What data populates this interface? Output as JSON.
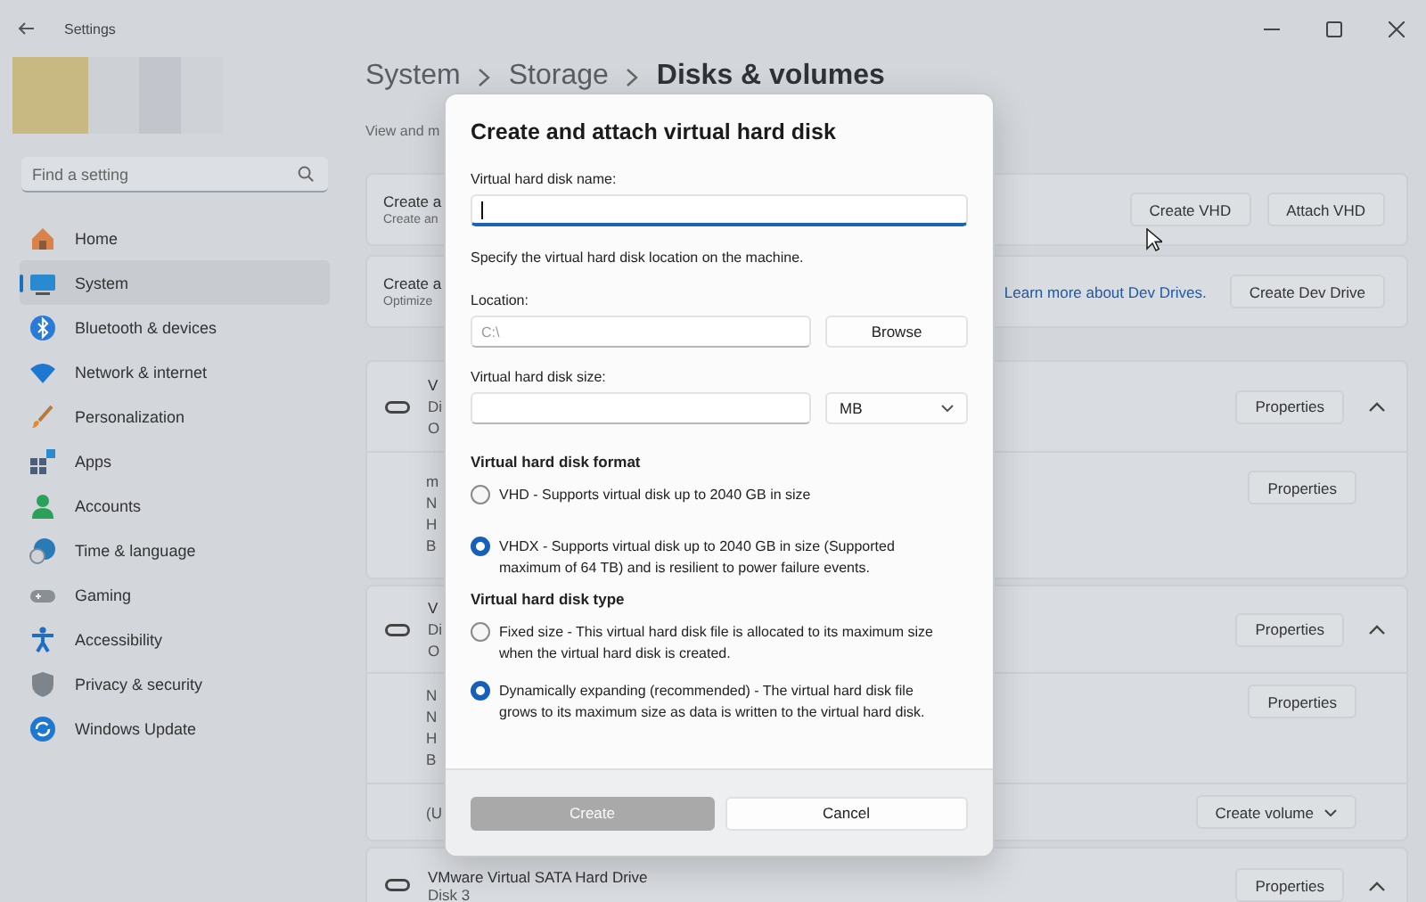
{
  "window": {
    "title": "Settings"
  },
  "sidebar": {
    "search": {
      "placeholder": "Find a setting"
    },
    "items": [
      {
        "label": "Home",
        "selected": false
      },
      {
        "label": "System",
        "selected": true
      },
      {
        "label": "Bluetooth & devices",
        "selected": false
      },
      {
        "label": "Network & internet",
        "selected": false
      },
      {
        "label": "Personalization",
        "selected": false
      },
      {
        "label": "Apps",
        "selected": false
      },
      {
        "label": "Accounts",
        "selected": false
      },
      {
        "label": "Time & language",
        "selected": false
      },
      {
        "label": "Gaming",
        "selected": false
      },
      {
        "label": "Accessibility",
        "selected": false
      },
      {
        "label": "Privacy & security",
        "selected": false
      },
      {
        "label": "Windows Update",
        "selected": false
      }
    ]
  },
  "main": {
    "breadcrumb": [
      "System",
      "Storage",
      "Disks & volumes"
    ],
    "subtitle": "View and m",
    "cards": [
      {
        "title": "Create a",
        "subtitle": "Create an",
        "buttons": [
          "Create VHD",
          "Attach VHD"
        ]
      },
      {
        "title": "Create a",
        "subtitle": "Optimize",
        "link": "Learn more about Dev Drives.",
        "buttons": [
          "Create Dev Drive"
        ]
      }
    ],
    "disks": [
      {
        "lines": [
          "V",
          "Di",
          "O"
        ],
        "button": "Properties",
        "expanded": true,
        "volumes": [
          {
            "lines": [
              "m",
              "N",
              "H",
              "B"
            ],
            "button": "Properties",
            "dropdown": false
          }
        ]
      },
      {
        "lines": [
          "V",
          "Di",
          "O"
        ],
        "button": "Properties",
        "expanded": true,
        "volumes": [
          {
            "lines": [
              "N",
              "N",
              "H",
              "B"
            ],
            "button": "Properties",
            "dropdown": false
          },
          {
            "lines": [
              "(U"
            ],
            "button": "Create volume",
            "dropdown": true
          }
        ]
      },
      {
        "lines": [
          "VMware Virtual SATA Hard Drive",
          "Disk 3"
        ],
        "button": "Properties",
        "expanded": true
      }
    ]
  },
  "dialog": {
    "title": "Create and attach virtual hard disk",
    "name_field": {
      "label": "Virtual hard disk name:",
      "focused": true
    },
    "location_hint": "Specify the virtual hard disk location on the machine.",
    "location": {
      "label": "Location:",
      "placeholder": "C:\\",
      "button": "Browse"
    },
    "size": {
      "label": "Virtual hard disk size:",
      "unit": "MB"
    },
    "format": {
      "heading": "Virtual hard disk format",
      "options": [
        {
          "label": "VHD - Supports virtual disk up to 2040 GB in size",
          "selected": false
        },
        {
          "label": "VHDX - Supports virtual disk up to 2040 GB in size (Supported maximum of 64 TB) and is resilient to power failure events.",
          "selected": true
        }
      ]
    },
    "type": {
      "heading": "Virtual hard disk type",
      "options": [
        {
          "label": "Fixed size - This virtual hard disk file is allocated to its maximum size when the virtual hard disk is created.",
          "selected": false
        },
        {
          "label": "Dynamically expanding (recommended) - The virtual hard disk file grows to its maximum size as data is written to the virtual hard disk.",
          "selected": true
        }
      ]
    },
    "buttons": [
      {
        "label": "Create",
        "disabled": true
      },
      {
        "label": "Cancel",
        "disabled": false
      }
    ]
  }
}
